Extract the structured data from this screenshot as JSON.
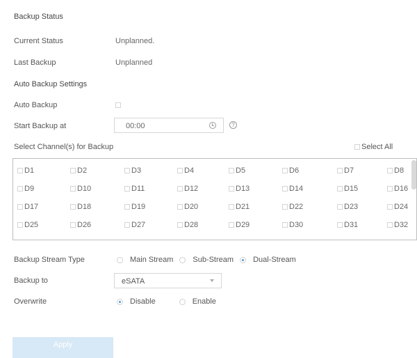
{
  "status": {
    "heading": "Backup Status",
    "current_label": "Current Status",
    "current_value": "Unplanned.",
    "last_label": "Last Backup",
    "last_value": "Unplanned"
  },
  "settings": {
    "heading": "Auto Backup Settings",
    "auto_label": "Auto Backup",
    "start_label": "Start Backup at",
    "start_value": "00:00",
    "help": "?",
    "channels_label": "Select Channel(s) for Backup",
    "select_all": "Select All"
  },
  "channels": [
    [
      "D1",
      "D2",
      "D3",
      "D4",
      "D5",
      "D6",
      "D7",
      "D8"
    ],
    [
      "D9",
      "D10",
      "D11",
      "D12",
      "D13",
      "D14",
      "D15",
      "D16"
    ],
    [
      "D17",
      "D18",
      "D19",
      "D20",
      "D21",
      "D22",
      "D23",
      "D24"
    ],
    [
      "D25",
      "D26",
      "D27",
      "D28",
      "D29",
      "D30",
      "D31",
      "D32"
    ]
  ],
  "stream": {
    "label": "Backup Stream Type",
    "options": [
      "Main Stream",
      "Sub-Stream",
      "Dual-Stream"
    ],
    "selected": "Dual-Stream"
  },
  "backup_to": {
    "label": "Backup to",
    "value": "eSATA"
  },
  "overwrite": {
    "label": "Overwrite",
    "options": [
      "Disable",
      "Enable"
    ],
    "selected": "Disable"
  },
  "apply_label": "Apply",
  "colors": {
    "accent": "#4a9bd6",
    "apply_bg": "#d7e8f6",
    "grid_border": "#bdbdbd"
  }
}
